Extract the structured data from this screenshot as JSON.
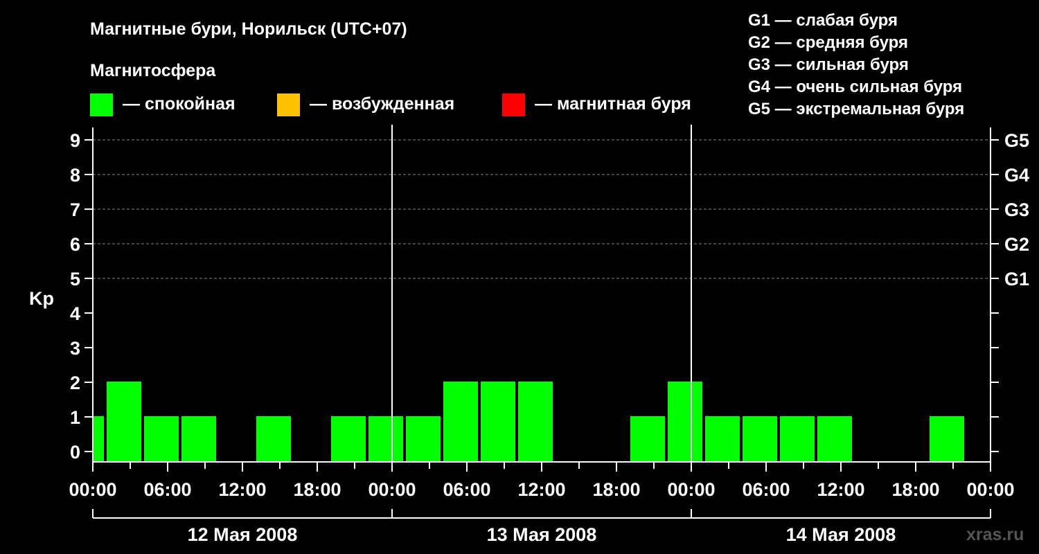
{
  "title": "Магнитные бури, Норильск (UTC+07)",
  "legend": {
    "heading": "Магнитосфера",
    "items": [
      {
        "label": "— спокойная",
        "color": "#00ff00"
      },
      {
        "label": "— возбужденная",
        "color": "#ffc000"
      },
      {
        "label": "— магнитная буря",
        "color": "#ff0000"
      }
    ]
  },
  "g_scale": [
    {
      "level": "G1",
      "text": "G1 — слабая буря"
    },
    {
      "level": "G2",
      "text": "G2 — средняя буря"
    },
    {
      "level": "G3",
      "text": "G3 — сильная буря"
    },
    {
      "level": "G4",
      "text": "G4 — очень сильная буря"
    },
    {
      "level": "G5",
      "text": "G5 — экстремальная буря"
    }
  ],
  "watermark": "xras.ru",
  "chart_data": {
    "type": "bar",
    "ylabel": "Kp",
    "ylim": [
      0,
      9
    ],
    "yticks": [
      "0",
      "1",
      "2",
      "3",
      "4",
      "5",
      "6",
      "7",
      "8",
      "9"
    ],
    "right_ticks": [
      {
        "kp": 5,
        "label": "G1"
      },
      {
        "kp": 6,
        "label": "G2"
      },
      {
        "kp": 7,
        "label": "G3"
      },
      {
        "kp": 8,
        "label": "G4"
      },
      {
        "kp": 9,
        "label": "G5"
      }
    ],
    "x_tick_labels": [
      "00:00",
      "06:00",
      "12:00",
      "18:00",
      "00:00",
      "06:00",
      "12:00",
      "18:00",
      "00:00",
      "06:00",
      "12:00",
      "18:00",
      "00:00"
    ],
    "days": [
      "12 Мая 2008",
      "13 Мая 2008",
      "14 Мая 2008"
    ],
    "x_unit": "hours from 12 May 2008 00:00 (UTC+07)",
    "xlim": [
      0,
      72
    ],
    "bars": [
      {
        "start": 0,
        "end": 1,
        "kp": 1
      },
      {
        "start": 1,
        "end": 4,
        "kp": 2
      },
      {
        "start": 4,
        "end": 7,
        "kp": 1
      },
      {
        "start": 7,
        "end": 10,
        "kp": 1
      },
      {
        "start": 10,
        "end": 13,
        "kp": 0
      },
      {
        "start": 13,
        "end": 16,
        "kp": 1
      },
      {
        "start": 16,
        "end": 19,
        "kp": 0
      },
      {
        "start": 19,
        "end": 22,
        "kp": 1
      },
      {
        "start": 22,
        "end": 25,
        "kp": 1
      },
      {
        "start": 25,
        "end": 28,
        "kp": 1
      },
      {
        "start": 28,
        "end": 31,
        "kp": 2
      },
      {
        "start": 31,
        "end": 34,
        "kp": 2
      },
      {
        "start": 34,
        "end": 37,
        "kp": 2
      },
      {
        "start": 37,
        "end": 40,
        "kp": 0
      },
      {
        "start": 40,
        "end": 43,
        "kp": 0
      },
      {
        "start": 43,
        "end": 46,
        "kp": 1
      },
      {
        "start": 46,
        "end": 49,
        "kp": 2
      },
      {
        "start": 49,
        "end": 52,
        "kp": 1
      },
      {
        "start": 52,
        "end": 55,
        "kp": 1
      },
      {
        "start": 55,
        "end": 58,
        "kp": 1
      },
      {
        "start": 58,
        "end": 61,
        "kp": 1
      },
      {
        "start": 61,
        "end": 64,
        "kp": 0
      },
      {
        "start": 64,
        "end": 67,
        "kp": 0
      },
      {
        "start": 67,
        "end": 70,
        "kp": 1
      }
    ],
    "grid": "dashed horizontal at Kp 5-9",
    "bar_color": "#00ff00"
  }
}
